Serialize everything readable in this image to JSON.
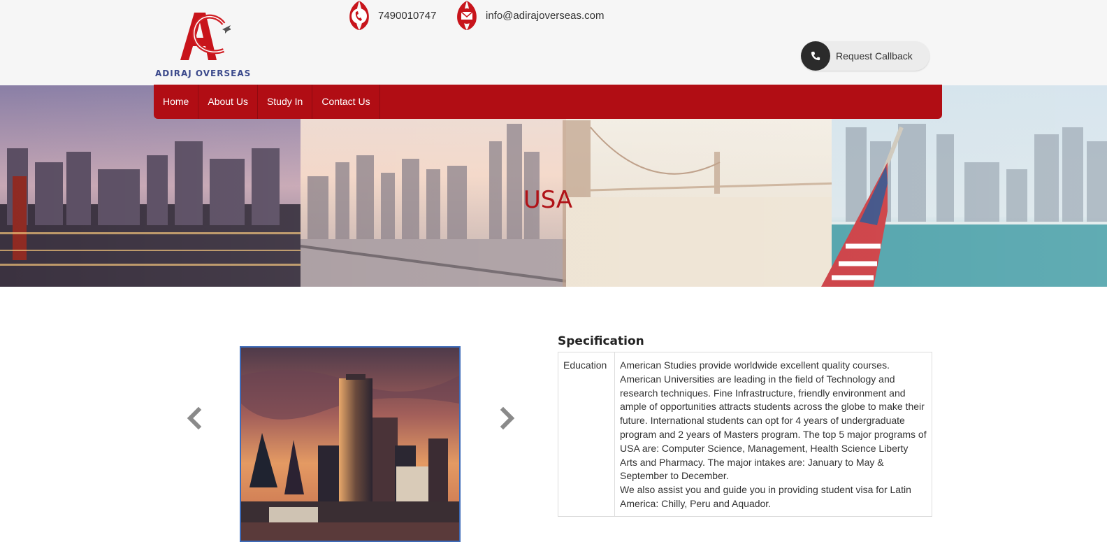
{
  "brand": {
    "name": "ADIRAJ OVERSEAS",
    "mark": "AO"
  },
  "header": {
    "phone": "7490010747",
    "email": "info@adirajoverseas.com",
    "callback_label": "Request Callback"
  },
  "nav": {
    "items": [
      {
        "label": "Home"
      },
      {
        "label": "About Us"
      },
      {
        "label": "Study In"
      },
      {
        "label": "Contact Us"
      }
    ]
  },
  "banner": {
    "title": "USA"
  },
  "specification": {
    "title": "Specification",
    "rows": [
      {
        "key": "Education",
        "paragraphs": [
          "American Studies provide worldwide excellent quality courses. American Universities are leading in the field of Technology and research techniques. Fine Infrastructure, friendly environment and ample of opportunities attracts students across the globe to make their future. International students can opt for 4 years of undergraduate program and 2 years of Masters program. The top 5 major programs of USA are: Computer Science, Management, Health Science Liberty Arts and Pharmacy. The major intakes are: January to May & September to December.",
          "We also assist you and guide you in providing student visa for Latin America: Chilly, Peru and Aquador."
        ]
      }
    ]
  },
  "icons": {
    "phone": "phone-icon",
    "email": "email-icon",
    "callback": "phone-icon",
    "prev": "chevron-left-icon",
    "next": "chevron-right-icon"
  },
  "colors": {
    "brand_red": "#b10d14",
    "title_red": "#b01217",
    "logo_blue": "#3c4a8c",
    "slide_border": "#3e6bb8"
  }
}
